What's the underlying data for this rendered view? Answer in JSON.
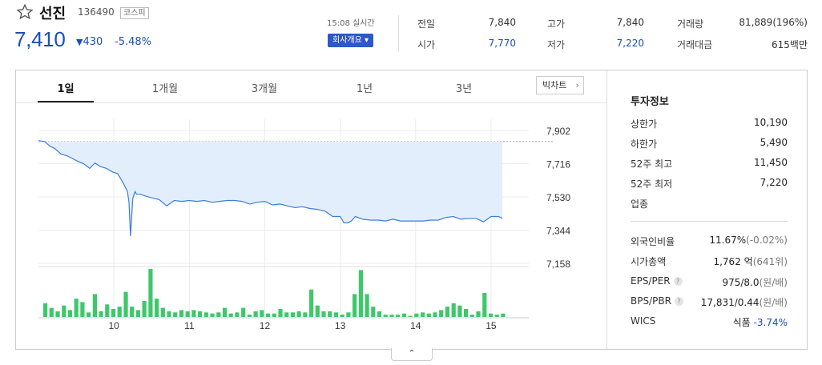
{
  "stock": {
    "name": "선진",
    "code": "136490",
    "market": "코스피",
    "price": "7,410",
    "change_arrow": "▼",
    "change": "430",
    "change_rate": "-5.48%"
  },
  "realtime": {
    "time": "15:08 실시간",
    "company_button": "회사개요 ▾"
  },
  "quote": {
    "prev_close_label": "전일",
    "prev_close": "7,840",
    "open_label": "시가",
    "open": "7,770",
    "high_label": "고가",
    "high": "7,840",
    "low_label": "저가",
    "low": "7,220",
    "volume_label": "거래량",
    "volume": "81,889(196%)",
    "value_label": "거래대금",
    "value": "615백만"
  },
  "tabs": [
    "1일",
    "1개월",
    "3개월",
    "1년",
    "3년"
  ],
  "big_chart_button": "빅차트",
  "colors": {
    "accent_blue": "#1a4fb8",
    "up_red": "#d11b1b",
    "line": "#3b7ddd",
    "fill": "#e3eefc",
    "volume_bar": "#3fc76b"
  },
  "chart_data": {
    "type": "line",
    "y_ticks": [
      "7,902",
      "7,716",
      "7,530",
      "7,344",
      "7,158"
    ],
    "ylim": [
      7158,
      7902
    ],
    "prev_close": 7840,
    "x_ticks": [
      "10",
      "11",
      "12",
      "13",
      "14",
      "15"
    ],
    "xlim": [
      9.0,
      15.5
    ],
    "x": [
      9.0,
      9.08,
      9.15,
      9.22,
      9.3,
      9.38,
      9.45,
      9.52,
      9.6,
      9.68,
      9.75,
      9.82,
      9.9,
      9.98,
      10.05,
      10.12,
      10.18,
      10.2,
      10.22,
      10.25,
      10.28,
      10.3,
      10.35,
      10.42,
      10.5,
      10.6,
      10.7,
      10.8,
      10.9,
      11.0,
      11.1,
      11.2,
      11.3,
      11.4,
      11.5,
      11.6,
      11.7,
      11.8,
      11.9,
      12.0,
      12.1,
      12.2,
      12.3,
      12.4,
      12.5,
      12.6,
      12.7,
      12.8,
      12.9,
      13.0,
      13.05,
      13.1,
      13.15,
      13.2,
      13.3,
      13.4,
      13.5,
      13.6,
      13.7,
      13.8,
      13.9,
      14.0,
      14.1,
      14.2,
      14.3,
      14.4,
      14.5,
      14.6,
      14.7,
      14.8,
      14.9,
      15.0,
      15.1,
      15.15
    ],
    "price": [
      7845,
      7840,
      7815,
      7800,
      7770,
      7760,
      7745,
      7730,
      7715,
      7690,
      7720,
      7700,
      7690,
      7670,
      7660,
      7610,
      7560,
      7500,
      7310,
      7520,
      7560,
      7545,
      7545,
      7535,
      7525,
      7515,
      7480,
      7510,
      7505,
      7510,
      7505,
      7510,
      7500,
      7505,
      7510,
      7510,
      7505,
      7490,
      7500,
      7505,
      7485,
      7490,
      7480,
      7470,
      7475,
      7465,
      7460,
      7450,
      7420,
      7420,
      7385,
      7385,
      7395,
      7420,
      7405,
      7400,
      7400,
      7395,
      7405,
      7395,
      7395,
      7395,
      7395,
      7400,
      7400,
      7415,
      7420,
      7405,
      7410,
      7410,
      7390,
      7420,
      7420,
      7410
    ],
    "volume": [
      12,
      8,
      5,
      10,
      6,
      16,
      13,
      4,
      20,
      5,
      11,
      7,
      9,
      22,
      9,
      6,
      14,
      42,
      16,
      8,
      5,
      4,
      6,
      5,
      6,
      5,
      4,
      3,
      4,
      8,
      3,
      4,
      8,
      2,
      5,
      6,
      3,
      3,
      7,
      4,
      4,
      5,
      4,
      24,
      10,
      5,
      5,
      4,
      2,
      4,
      20,
      41,
      20,
      9,
      5,
      2,
      2,
      2,
      3,
      1,
      3,
      4,
      3,
      4,
      6,
      9,
      12,
      10,
      7,
      2,
      5,
      21,
      3,
      2,
      3
    ]
  },
  "side": {
    "title": "투자정보",
    "upper_limit_label": "상한가",
    "upper_limit": "10,190",
    "lower_limit_label": "하한가",
    "lower_limit": "5,490",
    "w52_high_label": "52주 최고",
    "w52_high": "11,450",
    "w52_low_label": "52주 최저",
    "w52_low": "7,220",
    "industry_label": "업종",
    "foreign_label": "외국인비율",
    "foreign": "11.67%",
    "foreign_chg": "(-0.02%)",
    "mcap_label": "시가총액",
    "mcap": "1,762 억",
    "mcap_rank": "(641위)",
    "eps_label": "EPS/PER",
    "eps": "975/8.0",
    "eps_unit": "(원/배)",
    "bps_label": "BPS/PBR",
    "bps": "17,831/0.44",
    "bps_unit": "(원/배)",
    "wics_label": "WICS",
    "wics": "식품",
    "wics_chg": "-3.74%",
    "help_icon": "?"
  },
  "toggle_icon": "⌃"
}
